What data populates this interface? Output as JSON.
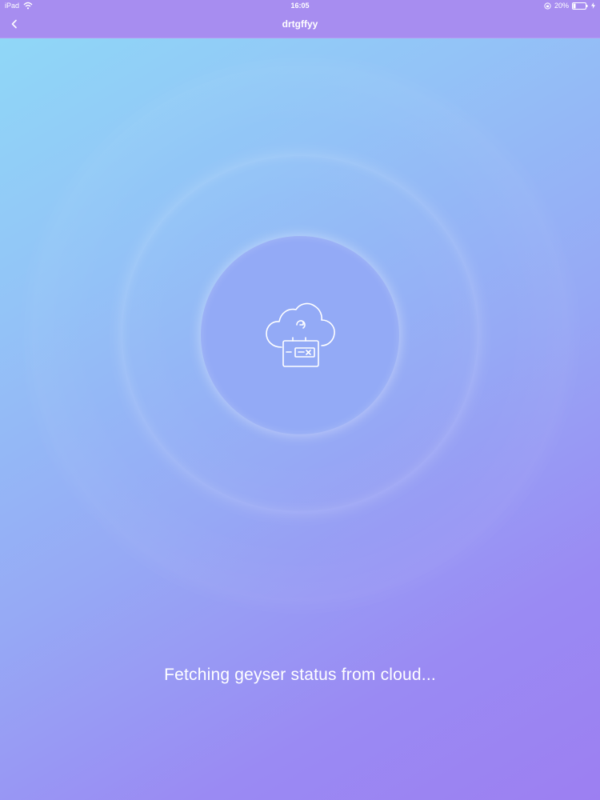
{
  "status_bar": {
    "device": "iPad",
    "time": "16:05",
    "battery_percent": "20%",
    "battery_level": 0.2,
    "icons": [
      "wifi-icon",
      "rotation-lock-icon",
      "battery-icon",
      "charging-icon"
    ]
  },
  "nav": {
    "back_icon": "chevron-left-icon",
    "title": "drtgffyy"
  },
  "main": {
    "center_icon": "cloud-device-icon",
    "message": "Fetching geyser status from cloud..."
  },
  "colors": {
    "nav_background": "#a78df0",
    "gradient_top_left": "#8fdaf7",
    "gradient_bottom_right": "#9c7ff2",
    "text": "#ffffff"
  }
}
